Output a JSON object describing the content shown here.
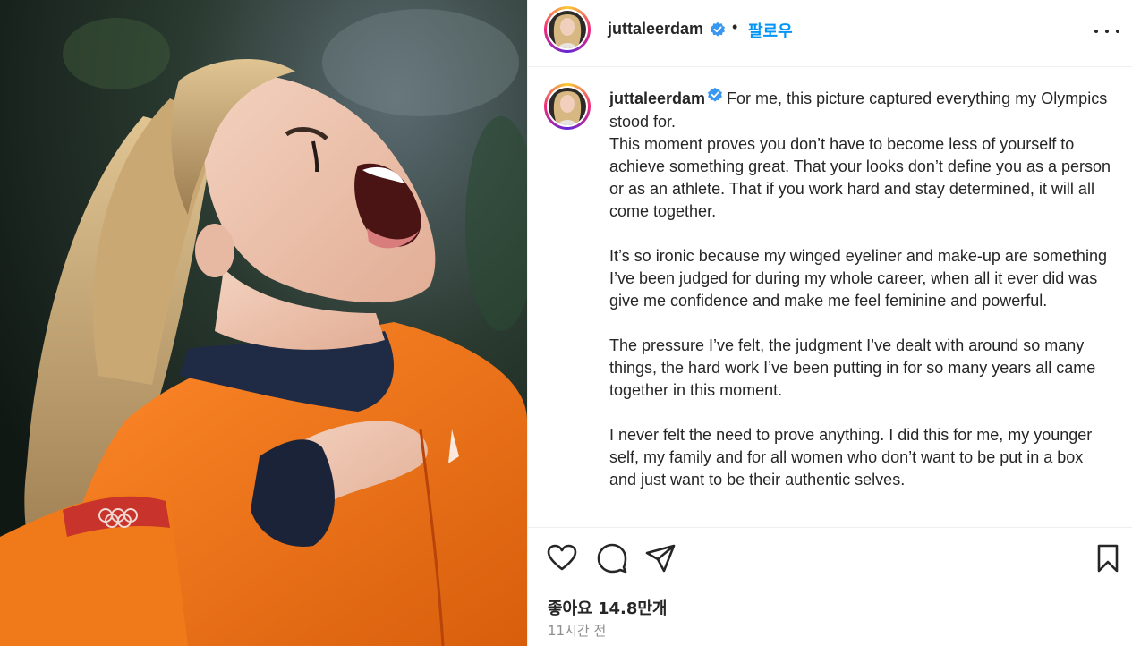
{
  "header": {
    "username": "juttaleerdam",
    "separator": "•",
    "follow_label": "팔로우"
  },
  "caption": {
    "username": "juttaleerdam",
    "paragraphs": [
      "For me, this picture captured everything my Olympics stood for.",
      "This moment proves you don’t have to become less of yourself to achieve something great. That your looks don’t define you as a person or as an athlete. That if you work hard and stay determined, it will all come together.",
      "It’s so ironic because my winged eyeliner and make-up are something I’ve been judged for during my whole career, when all it ever did was give me confidence and make me feel feminine and powerful.",
      "The pressure I’ve felt, the judgment I’ve dealt with around so many things, the hard work I’ve been putting in for so many years all came together in this moment.",
      "I never felt the need to prove anything. I did this for me, my younger self, my family and for all women who don’t want to be put in a box and just want to be their authentic selves."
    ]
  },
  "icons": {
    "like": "heart-icon",
    "comment": "comment-icon",
    "share": "paper-plane-icon",
    "save": "bookmark-icon",
    "more": "more-options-icon",
    "verified": "verified-badge-icon"
  },
  "stats": {
    "likes_text": "좋아요 14.8만개",
    "time_text": "11시간 전"
  },
  "colors": {
    "follow": "#0095f6",
    "verified": "#3897f0",
    "suit_orange": "#f07a1a",
    "muted_text": "#8e8e8e"
  }
}
